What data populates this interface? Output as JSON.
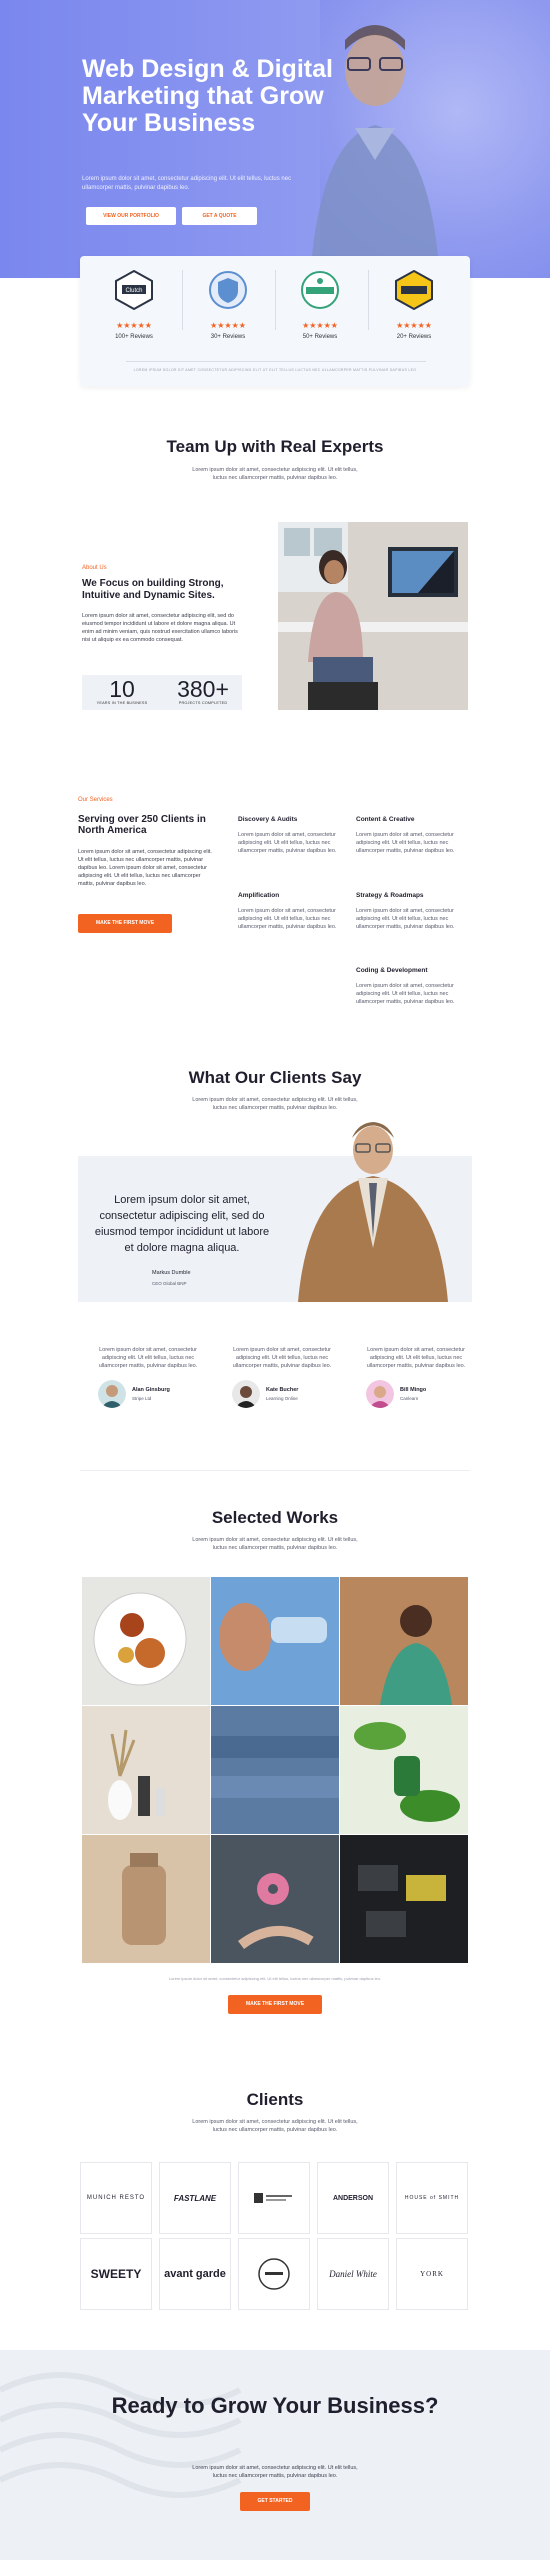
{
  "hero": {
    "title": "Web Design & Digital Marketing that Grow Your Business",
    "subtitle": "Lorem ipsum dolor sit amet, consectetur adipiscing elit. Ut elit tellus, luctus nec ullamcorper mattis, pulvinar dapibus leo.",
    "btn_portfolio": "VIEW OUR PORTFOLIO",
    "btn_quote": "GET A QUOTE"
  },
  "reviews": {
    "items": [
      {
        "badge": "Clutch",
        "stars": "★★★★★",
        "count": "100+ Reviews"
      },
      {
        "badge": "",
        "stars": "★★★★★",
        "count": "30+ Reviews"
      },
      {
        "badge": "",
        "stars": "★★★★★",
        "count": "50+ Reviews"
      },
      {
        "badge": "",
        "stars": "★★★★★",
        "count": "20+ Reviews"
      }
    ],
    "note": "LOREM IPSUM DOLOR SIT AMET CONSECTETUR ADIPISCING ELIT UT ELIT TELLUS LUCTUS NEC ULLAMCORPER MATTIS PULVINAR DAPIBUS LEO"
  },
  "team": {
    "title": "Team Up with Real Experts",
    "subtitle": "Lorem ipsum dolor sit amet, consectetur adipiscing elit. Ut elit tellus, luctus nec ullamcorper mattis, pulvinar dapibus leo."
  },
  "about": {
    "label": "About Us",
    "heading": "We Focus on building Strong, Intuitive and Dynamic Sites.",
    "body": "Lorem ipsum dolor sit amet, consectetur adipiscing elit, sed do eiusmod tempor incididunt ut labore et dolore magna aliqua. Ut enim ad minim veniam, quis nostrud exercitation ullamco laboris nisi ut aliquip ex ea commodo consequat.",
    "stat1_num": "10",
    "stat1_label": "YEARS IN THE BUSINESS",
    "stat2_num": "380+",
    "stat2_label": "PROJECTS COMPLETED"
  },
  "services": {
    "label": "Our Services",
    "heading": "Serving over 250 Clients in North America",
    "body": "Lorem ipsum dolor sit amet, consectetur adipiscing elit. Ut elit tellus, luctus nec ullamcorper mattis, pulvinar dapibus leo. Lorem ipsum dolor sit amet, consectetur adipiscing elit. Ut elit tellus, luctus nec ullamcorper mattis, pulvinar dapibus leo.",
    "button": "MAKE THE FIRST MOVE",
    "items": [
      {
        "title": "Discovery & Audits",
        "desc": "Lorem ipsum dolor sit amet, consectetur adipiscing elit. Ut elit tellus, luctus nec ullamcorper mattis, pulvinar dapibus leo."
      },
      {
        "title": "Content & Creative",
        "desc": "Lorem ipsum dolor sit amet, consectetur adipiscing elit. Ut elit tellus, luctus nec ullamcorper mattis, pulvinar dapibus leo."
      },
      {
        "title": "Amplification",
        "desc": "Lorem ipsum dolor sit amet, consectetur adipiscing elit. Ut elit tellus, luctus nec ullamcorper mattis, pulvinar dapibus leo."
      },
      {
        "title": "Strategy & Roadmaps",
        "desc": "Lorem ipsum dolor sit amet, consectetur adipiscing elit. Ut elit tellus, luctus nec ullamcorper mattis, pulvinar dapibus leo."
      },
      {
        "title": "Coding & Development",
        "desc": "Lorem ipsum dolor sit amet, consectetur adipiscing elit. Ut elit tellus, luctus nec ullamcorper mattis, pulvinar dapibus leo."
      }
    ]
  },
  "testimonials": {
    "title": "What Our Clients Say",
    "subtitle": "Lorem ipsum dolor sit amet, consectetur adipiscing elit. Ut elit tellus, luctus nec ullamcorper mattis, pulvinar dapibus leo.",
    "quote": "Lorem ipsum dolor sit amet, consectetur adipiscing elit, sed do eiusmod tempor incididunt ut labore et dolore magna aliqua.",
    "name": "Markus Dumble",
    "role": "CEO Global BNP",
    "others": [
      {
        "quote": "Lorem ipsum dolor sit amet, consectetur adipiscing elit. Ut elit tellus, luctus nec ullamcorper mattis, pulvinar dapibus leo.",
        "name": "Alan Ginsburg",
        "role": "Stripe Ltd"
      },
      {
        "quote": "Lorem ipsum dolor sit amet, consectetur adipiscing elit. Ut elit tellus, luctus nec ullamcorper mattis, pulvinar dapibus leo.",
        "name": "Kate Bucher",
        "role": "Learning Online"
      },
      {
        "quote": "Lorem ipsum dolor sit amet, consectetur adipiscing elit. Ut elit tellus, luctus nec ullamcorper mattis, pulvinar dapibus leo.",
        "name": "Bill Mingo",
        "role": "Canlearn"
      }
    ]
  },
  "works": {
    "title": "Selected Works",
    "subtitle": "Lorem ipsum dolor sit amet, consectetur adipiscing elit. Ut elit tellus, luctus nec ullamcorper mattis, pulvinar dapibus leo.",
    "note": "Lorem ipsum dolor sit amet, consectetur adipiscing elit. Ut elit tellus, luctus nec ullamcorper mattis, pulvinar dapibus leo.",
    "button": "MAKE THE FIRST MOVE"
  },
  "clients": {
    "title": "Clients",
    "subtitle": "Lorem ipsum dolor sit amet, consectetur adipiscing elit. Ut elit tellus, luctus nec ullamcorper mattis, pulvinar dapibus leo.",
    "logos": [
      "MUNICH RESTO",
      "FASTLANE",
      "",
      "ANDERSON",
      "HOUSE of SMITH",
      "SWEETY",
      "avant garde",
      "",
      "Daniel White",
      "YORK"
    ]
  },
  "cta": {
    "title": "Ready to Grow Your Business?",
    "body": "Lorem ipsum dolor sit amet, consectetur adipiscing elit. Ut elit tellus, luctus nec ullamcorper mattis, pulvinar dapibus leo.",
    "button": "GET STARTED"
  },
  "colors": {
    "accent": "#f26322",
    "hero": "#7a87ee",
    "panel": "#eef1f6"
  }
}
